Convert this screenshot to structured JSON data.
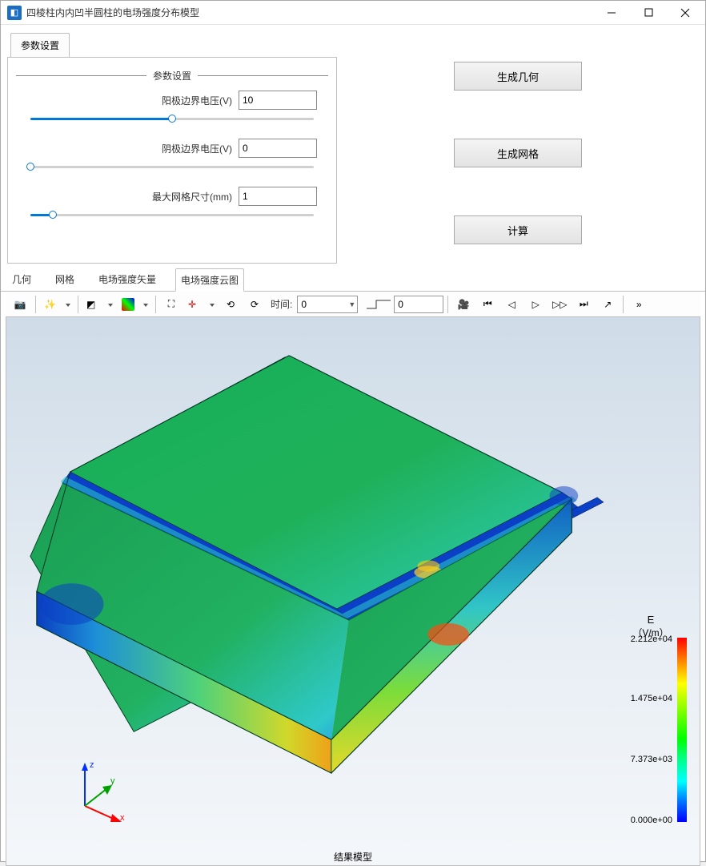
{
  "window": {
    "title": "四棱柱内内凹半圆柱的电场强度分布模型"
  },
  "top_tab": {
    "label": "参数设置"
  },
  "params": {
    "legend": "参数设置",
    "anode": {
      "label": "阳极边界电压(V)",
      "value": "10",
      "slider_pct": 50
    },
    "cathode": {
      "label": "阴极边界电压(V)",
      "value": "0",
      "slider_pct": 0
    },
    "mesh": {
      "label": "最大网格尺寸(mm)",
      "value": "1",
      "slider_pct": 8
    }
  },
  "actions": {
    "geom": "生成几何",
    "mesh": "生成网格",
    "calc": "计算"
  },
  "view_tabs": {
    "geom": "几何",
    "mesh": "网格",
    "vector": "电场强度矢量",
    "contour": "电场强度云图",
    "active": "contour"
  },
  "toolbar": {
    "time_label": "时间:",
    "time_value": "0",
    "time_step": "0"
  },
  "legend": {
    "title": "E",
    "unit": "（V/m）",
    "ticks": {
      "max": "2.212e+04",
      "t2": "1.475e+04",
      "t1": "7.373e+03",
      "min": "0.000e+00"
    }
  },
  "axes": {
    "x": "x",
    "y": "y",
    "z": "z"
  },
  "viewer_footer": "结果模型"
}
